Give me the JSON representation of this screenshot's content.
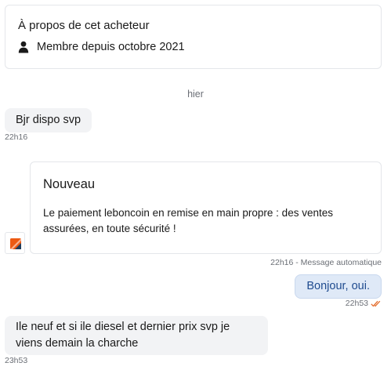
{
  "about": {
    "title": "À propos de cet acheteur",
    "member_since": "Membre depuis octobre 2021"
  },
  "day_separator": "hier",
  "messages": [
    {
      "text": "Bjr dispo svp",
      "time": "22h16"
    },
    {
      "text": "Bonjour, oui.",
      "time": "22h53"
    },
    {
      "text": "Ile neuf et si ile diesel et dernier prix svp je viens demain la charche",
      "time": "23h53"
    }
  ],
  "system_message": {
    "title": "Nouveau",
    "body": "Le paiement leboncoin en remise en main propre : des ventes assurées, en toute sécurité !",
    "meta": "22h16 - Message automatique"
  },
  "icons": {
    "about": "person-icon",
    "system_avatar": "leboncoin-logo-icon",
    "read_status": "double-check-icon"
  },
  "colors": {
    "outgoing_bubble": "#dfe9f7",
    "outgoing_text": "#1f4b8f",
    "incoming_bubble": "#f2f3f5",
    "read_ticks": "#e46e2e",
    "logo": "#ec5a13"
  }
}
